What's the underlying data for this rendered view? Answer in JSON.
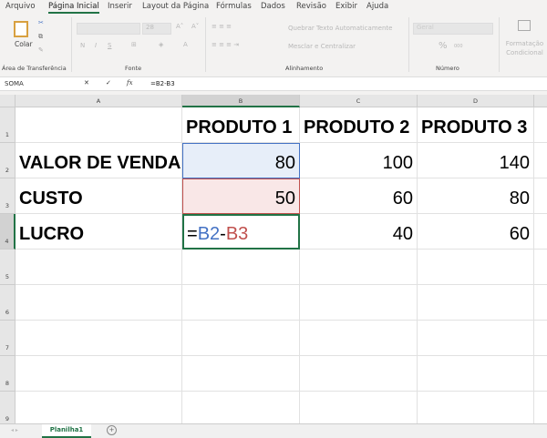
{
  "menu": [
    "Arquivo",
    "Página Inicial",
    "Inserir",
    "Layout da Página",
    "Fórmulas",
    "Dados",
    "Revisão",
    "Exibir",
    "Ajuda"
  ],
  "ribbon": {
    "paste_label": "Colar",
    "clipboard_group": "Área de Transferência",
    "font_size": "28",
    "bold": "N",
    "italic": "I",
    "underline": "S",
    "font_group": "Fonte",
    "wrap_text": "Quebrar Texto Automaticamente",
    "merge_center": "Mesclar e Centralizar",
    "alignment_group": "Alinhamento",
    "number_format": "Geral",
    "percent": "%",
    "thousands": "000",
    "number_group": "Número",
    "conditional_format": "Formatação Condicional"
  },
  "formula_bar": {
    "name_box": "SOMA",
    "fx": "fx",
    "formula": "=B2-B3"
  },
  "columns": [
    "A",
    "B",
    "C",
    "D"
  ],
  "rows": [
    "1",
    "2",
    "3",
    "4",
    "5",
    "6",
    "7",
    "8",
    "9"
  ],
  "cells": {
    "A1": "",
    "B1": "PRODUTO 1",
    "C1": "PRODUTO 2",
    "D1": "PRODUTO 3",
    "A2": "VALOR DE VENDA",
    "B2": "80",
    "C2": "100",
    "D2": "140",
    "A3": "CUSTO",
    "B3": "50",
    "C3": "60",
    "D3": "80",
    "A4": "LUCRO",
    "C4": "40",
    "D4": "60"
  },
  "editing": {
    "eq": "=",
    "ref1": "B2",
    "op": "-",
    "ref2": "B3"
  },
  "colors": {
    "ref1": "#4472c4",
    "ref2": "#c0504d",
    "accent": "#217346"
  },
  "sheet_tabs": [
    "Planilha1"
  ]
}
